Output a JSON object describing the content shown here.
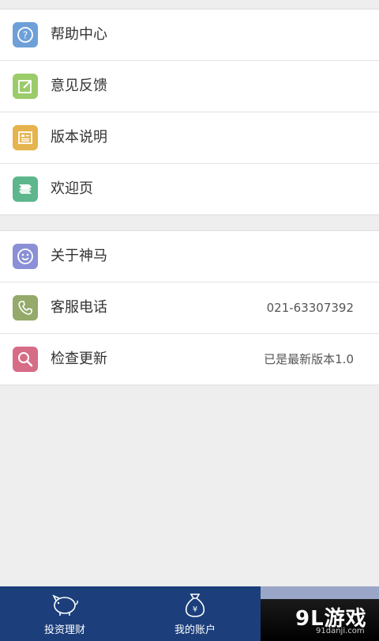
{
  "group1": {
    "items": [
      {
        "label": "帮助中心",
        "icon": "question-icon",
        "color": "#6ea0d8"
      },
      {
        "label": "意见反馈",
        "icon": "edit-note-icon",
        "color": "#9ccb6a"
      },
      {
        "label": "版本说明",
        "icon": "document-icon",
        "color": "#e5b44e"
      },
      {
        "label": "欢迎页",
        "icon": "welcome-flag-icon",
        "color": "#5db68c"
      }
    ]
  },
  "group2": {
    "items": [
      {
        "label": "关于神马",
        "icon": "smiley-icon",
        "color": "#8b8fd6",
        "value": ""
      },
      {
        "label": "客服电话",
        "icon": "phone-icon",
        "color": "#94a96a",
        "value": "021-63307392"
      },
      {
        "label": "检查更新",
        "icon": "search-icon",
        "color": "#d66c86",
        "value": "已是最新版本1.0"
      }
    ]
  },
  "tabbar": {
    "tabs": [
      {
        "label": "投资理财",
        "icon": "piggy-bank-icon"
      },
      {
        "label": "我的账户",
        "icon": "money-bag-icon"
      }
    ],
    "background": "#1c3f7c"
  },
  "watermark": {
    "logo": "9L游戏",
    "site": "91danji.com"
  }
}
